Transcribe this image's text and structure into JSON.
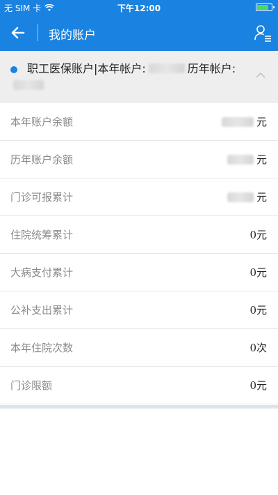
{
  "status_bar": {
    "carrier": "无 SIM 卡",
    "time": "下午12:00"
  },
  "nav": {
    "title": "我的账户"
  },
  "account": {
    "label_prefix": "职工医保账户|本年帐户:",
    "label_middle": "历年帐户:"
  },
  "rows": [
    {
      "label": "本年账户余额",
      "value": "",
      "unit": "元"
    },
    {
      "label": "历年账户余额",
      "value": "",
      "unit": "元"
    },
    {
      "label": "门诊可报累计",
      "value": "",
      "unit": "元"
    },
    {
      "label": "住院统筹累计",
      "value": "0",
      "unit": "元"
    },
    {
      "label": "大病支付累计",
      "value": "0",
      "unit": "元"
    },
    {
      "label": "公补支出累计",
      "value": "0",
      "unit": "元"
    },
    {
      "label": "本年住院次数",
      "value": "0",
      "unit": "次"
    },
    {
      "label": "门诊限额",
      "value": "0",
      "unit": "元"
    }
  ],
  "colors": {
    "brand": "#1a82e0",
    "header_bg": "#eeeeee",
    "label": "#8a8a8a"
  },
  "icons": [
    "back-arrow-icon",
    "user-list-icon",
    "chevron-up-icon",
    "wifi-icon",
    "battery-icon"
  ]
}
